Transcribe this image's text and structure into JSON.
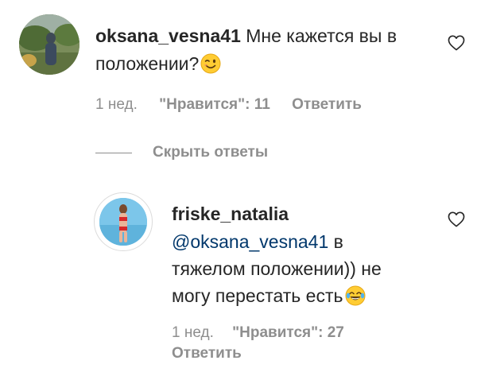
{
  "comment1": {
    "username": "oksana_vesna41",
    "text": "Мне кажется вы в положении?",
    "emoji_icon": "winking-face-icon",
    "time": "1 нед.",
    "likes": "\"Нравится\": 11",
    "reply_label": "Ответить"
  },
  "hide_replies_label": "Скрыть ответы",
  "reply1": {
    "username": "friske_natalia",
    "mention": "@oksana_vesna41",
    "text": " в тяжелом положении)) не могу перестать есть",
    "emoji_icon": "tears-of-joy-icon",
    "time": "1 нед.",
    "likes": "\"Нравится\": 27",
    "reply_label": "Ответить"
  },
  "colors": {
    "text": "#262626",
    "secondary": "#8e8e8e",
    "mention": "#00376b"
  }
}
